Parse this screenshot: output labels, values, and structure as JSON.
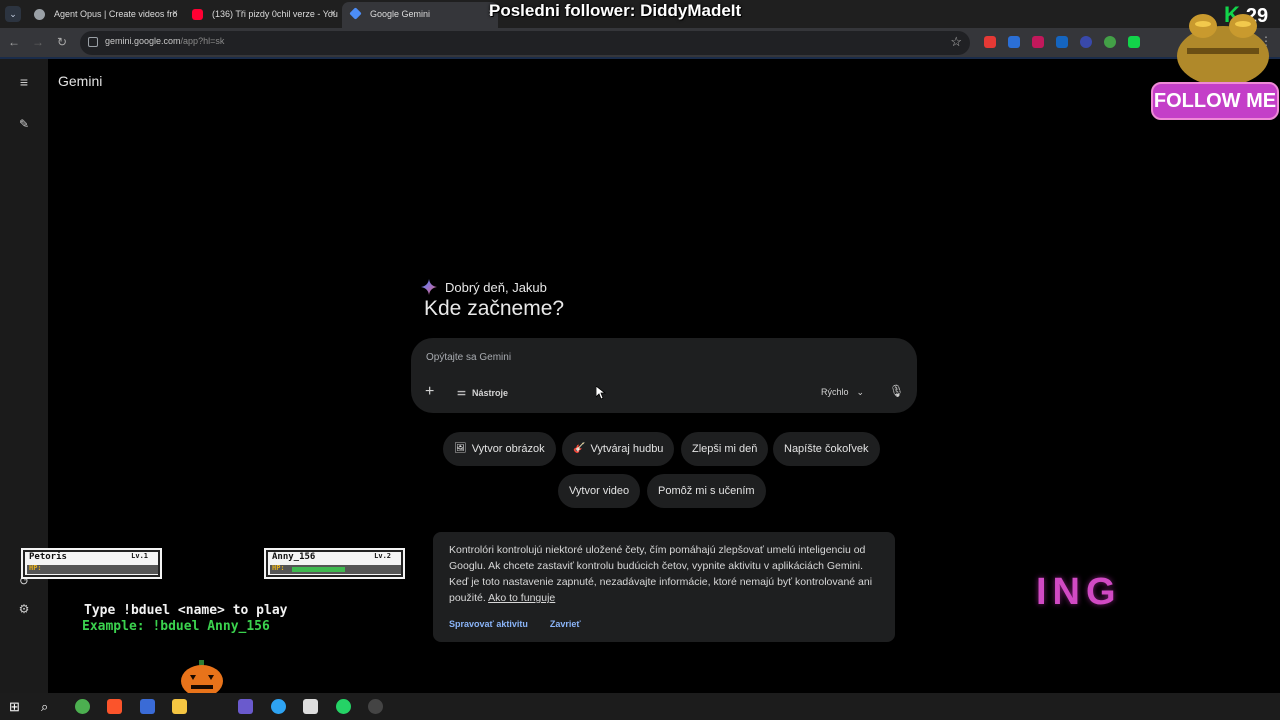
{
  "tabs": [
    {
      "title": "Agent Opus | Create videos fro",
      "close": "×",
      "favicon_color": "#9aa0a6"
    },
    {
      "title": "(136) Tři pizdy 0chil verze - You",
      "close": "×",
      "favicon_color": "#ff0033"
    },
    {
      "title": "Google Gemini",
      "close": "×",
      "favicon_color": "#4c8df6"
    }
  ],
  "stream": {
    "last_follower": "Posledni follower: DiddyMadeIt",
    "follow_me": "FOLLOW ME",
    "kick_count": "29",
    "kick_letter": "K",
    "ing_text": "ING"
  },
  "browser": {
    "url_host": "gemini.google.com",
    "url_path": "/app?hl=sk"
  },
  "app": {
    "title": "Gemini"
  },
  "greeting": {
    "hello": "Dobrý deň, Jakub",
    "headline": "Kde začneme?"
  },
  "prompt": {
    "placeholder": "Opýtajte sa Gemini",
    "plus": "+",
    "tools_label": "Nástroje",
    "model_label": "Rýchlo",
    "model_caret": "⌄"
  },
  "chips": [
    {
      "label": "Vytvor obrázok",
      "icon": "🖼"
    },
    {
      "label": "Vytváraj hudbu",
      "icon": "🎸"
    },
    {
      "label": "Zlepši mi deň",
      "icon": ""
    },
    {
      "label": "Napíšte čokoľvek",
      "icon": ""
    },
    {
      "label": "Vytvor video",
      "icon": ""
    },
    {
      "label": "Pomôž mi s učením",
      "icon": ""
    }
  ],
  "notice": {
    "text": "Kontrolóri kontrolujú niektoré uložené čety, čím pomáhajú zlepšovať umelú inteligenciu od Googlu. Ak chcete zastaviť kontrolu budúcich četov, vypnite aktivitu v aplikáciách Gemini. Keď je toto nastavenie zapnuté, nezadávajte informácie, ktoré nemajú byť kontrolované ani použité.",
    "link": "Ako to funguje",
    "manage": "Spravovať aktivitu",
    "close": "Zavrieť"
  },
  "duel": {
    "players": [
      {
        "name": "Petoris",
        "level": "Lv.1",
        "hp_label": "HP:",
        "hp_fraction": 0
      },
      {
        "name": "Anny_156",
        "level": "Lv.2",
        "hp_label": "HP:",
        "hp_fraction": 0.5
      }
    ],
    "command": "Type !bduel <name> to play",
    "example": "Example: !bduel Anny_156"
  },
  "colors": {
    "accent_link": "#8ab4f8",
    "kick_green": "#12d44a",
    "follow_pink": "#c43fc8"
  }
}
